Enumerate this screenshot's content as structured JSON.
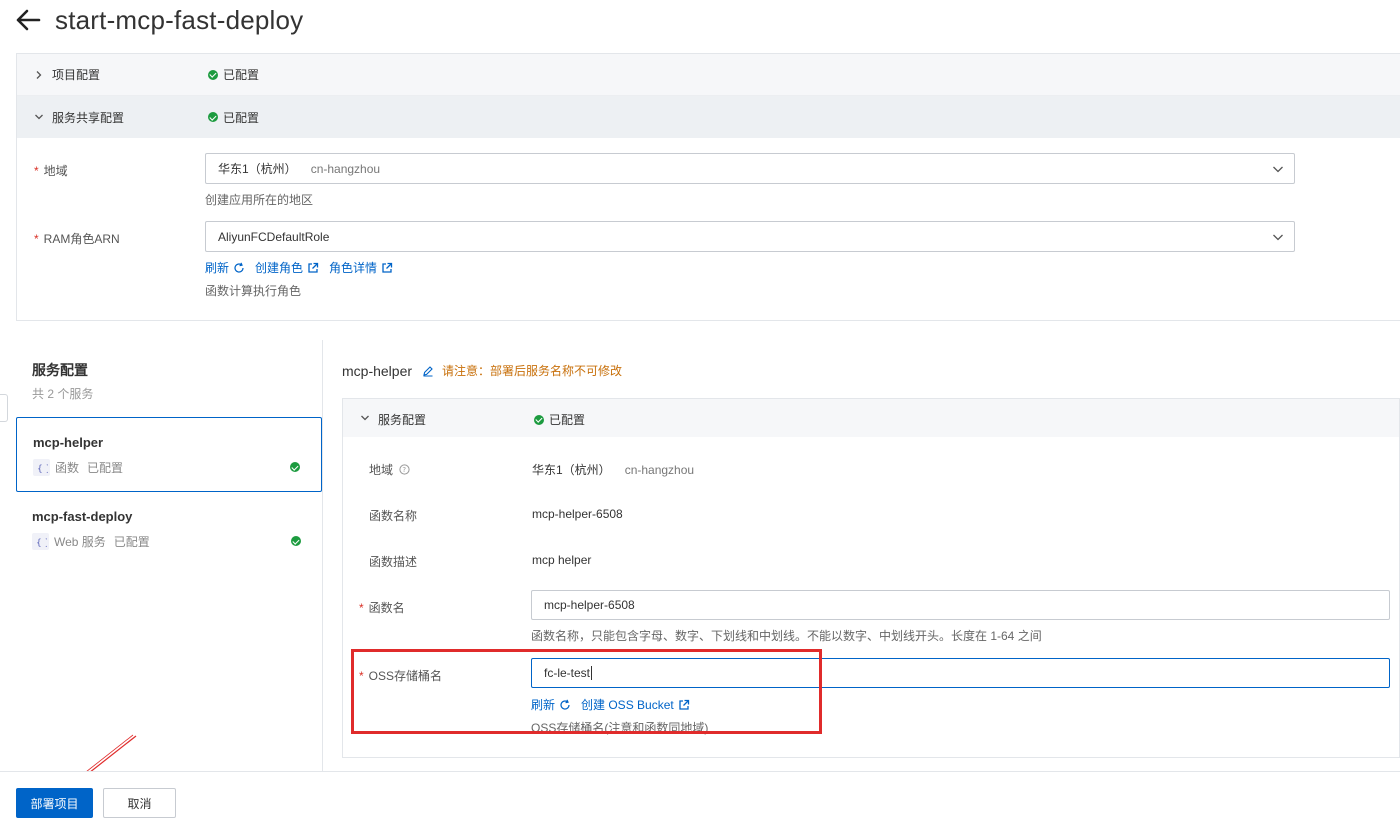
{
  "header": {
    "title": "start-mcp-fast-deploy",
    "back_icon": "arrow-left-icon"
  },
  "shared_config": {
    "project_section": {
      "label": "项目配置",
      "status": "已配置"
    },
    "shared_section": {
      "label": "服务共享配置",
      "status": "已配置"
    },
    "region": {
      "label": "地域",
      "value": "华东1（杭州）",
      "value_sub": "cn-hangzhou",
      "help": "创建应用所在的地区"
    },
    "ram_role": {
      "label": "RAM角色ARN",
      "value": "AliyunFCDefaultRole",
      "links": {
        "refresh": "刷新",
        "create": "创建角色",
        "details": "角色详情"
      },
      "help": "函数计算执行角色"
    }
  },
  "service_list": {
    "title": "服务配置",
    "count_text": "共 2 个服务",
    "items": [
      {
        "name": "mcp-helper",
        "type": "函数",
        "status": "已配置",
        "selected": true
      },
      {
        "name": "mcp-fast-deploy",
        "type": "Web 服务",
        "status": "已配置",
        "selected": false
      }
    ]
  },
  "service_detail": {
    "name": "mcp-helper",
    "warning": "请注意：部署后服务名称不可修改",
    "section": {
      "label": "服务配置",
      "status": "已配置"
    },
    "fields": {
      "region": {
        "label": "地域",
        "value": "华东1（杭州）",
        "value_sub": "cn-hangzhou"
      },
      "func_name_display": {
        "label": "函数名称",
        "value": "mcp-helper-6508"
      },
      "func_desc": {
        "label": "函数描述",
        "value": "mcp helper"
      },
      "func_name_input": {
        "label": "函数名",
        "value": "mcp-helper-6508",
        "help": "函数名称，只能包含字母、数字、下划线和中划线。不能以数字、中划线开头。长度在 1-64 之间"
      },
      "oss_bucket": {
        "label": "OSS存储桶名",
        "value": "fc-le-test",
        "links": {
          "refresh": "刷新",
          "create": "创建 OSS Bucket"
        },
        "help": "OSS存储桶名(注意和函数同地域)"
      }
    }
  },
  "footer": {
    "deploy_label": "部署项目",
    "cancel_label": "取消"
  },
  "colors": {
    "primary": "#0064c8",
    "success": "#1c9b3f",
    "warning": "#c8700b",
    "annotation": "#e02b2b"
  }
}
